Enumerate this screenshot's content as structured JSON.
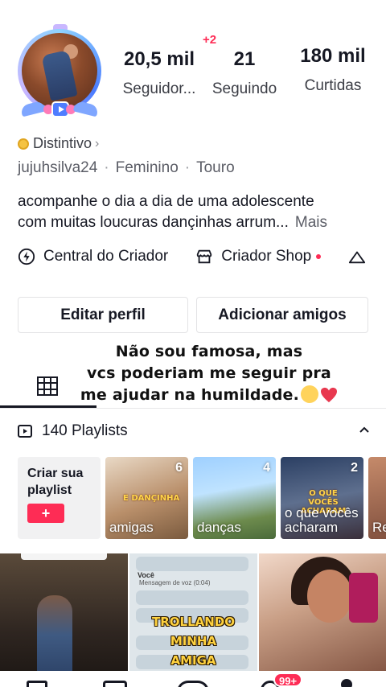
{
  "profile": {
    "followers": "20,5 mil",
    "followers_label": "Seguidor...",
    "followers_new": "+2",
    "following": "21",
    "following_label": "Seguindo",
    "likes": "180 mil",
    "likes_label": "Curtidas",
    "badge_label": "Distintivo",
    "username": "jujuhsilva24",
    "gender": "Feminino",
    "sign": "Touro",
    "bio_line1": "acompanhe o dia a dia de uma adolescente",
    "bio_line2": "com muitas loucuras dançinhas arrum...",
    "bio_more": "Mais"
  },
  "creator": {
    "central": "Central do Criador",
    "shop": "Criador Shop"
  },
  "buttons": {
    "edit": "Editar perfil",
    "add_friends": "Adicionar amigos"
  },
  "overlay_caption": {
    "line1": "Não sou famosa, mas",
    "line2": "vcs poderiam me seguir pra",
    "line3": "me ajudar na humildade."
  },
  "playlists": {
    "title": "140 Playlists",
    "create_label": "Criar sua playlist",
    "create_button": "+",
    "items": [
      {
        "name": "amigas",
        "count": "6",
        "sticker": "E DANÇINHA"
      },
      {
        "name": "danças",
        "count": "4",
        "sticker": ""
      },
      {
        "name": "o que vocês acharam",
        "count": "2",
        "sticker": "O QUE VOCÊS ACHARAM"
      },
      {
        "name": "Re a c",
        "count": "",
        "sticker": ""
      }
    ]
  },
  "videos": [
    {
      "caption": ""
    },
    {
      "caption_line1": "TROLLANDO",
      "caption_line2": "MINHA",
      "caption_line3": "AMIGA",
      "chat_sender": "Você",
      "chat_msg": "Mensagem de voz (0:04)"
    },
    {
      "caption": ""
    }
  ],
  "nav": {
    "inbox_badge": "99+"
  },
  "colors": {
    "accent": "#fe2c55",
    "text": "#161823",
    "muted": "#5b5d66"
  }
}
